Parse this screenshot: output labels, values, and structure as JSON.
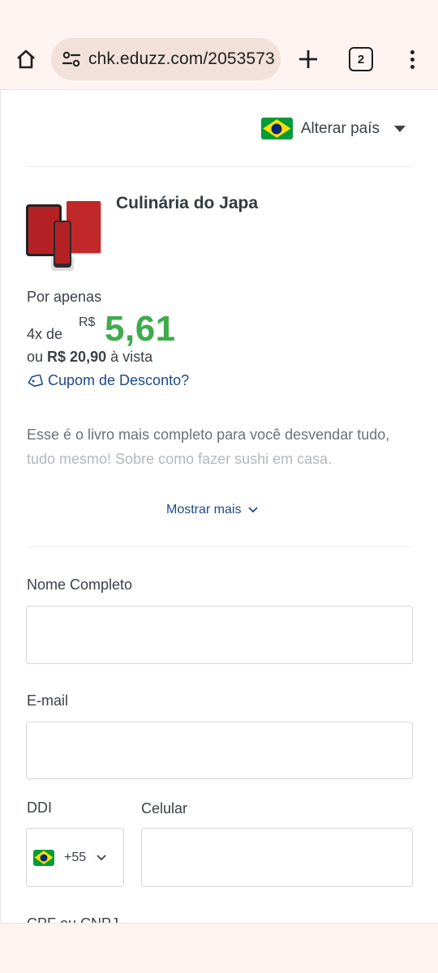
{
  "browser": {
    "url": "chk.eduzz.com/2053573",
    "tab_count": "2",
    "icons": [
      "home-icon",
      "site-settings-icon",
      "plus-icon",
      "tabs-icon",
      "more-vert-icon"
    ]
  },
  "country_selector": {
    "label": "Alterar país",
    "flag": "brazil-flag-icon"
  },
  "product": {
    "title": "Culinária do Japa",
    "por_apenas": "Por apenas",
    "installments": "4x de",
    "currency": "R$",
    "price": "5,61",
    "vista_prefix": "ou ",
    "vista_amount": "R$ 20,90",
    "vista_suffix": " à vista",
    "coupon_label": "Cupom de Desconto?",
    "description_line1": "Esse é o livro mais completo para você desvendar tudo,",
    "description_line2": "tudo mesmo! Sobre como fazer sushi em casa.",
    "show_more": "Mostrar mais"
  },
  "form": {
    "name_label": "Nome Completo",
    "name_value": "",
    "email_label": "E-mail",
    "email_value": "",
    "ddi_label": "DDI",
    "ddi_value": "+55",
    "phone_label": "Celular",
    "phone_value": "",
    "cpf_label": "CPF ou CNPJ"
  },
  "colors": {
    "price_green": "#3fab4d",
    "link_blue": "#1c4a8a",
    "browser_bg": "#fdf4f1"
  }
}
